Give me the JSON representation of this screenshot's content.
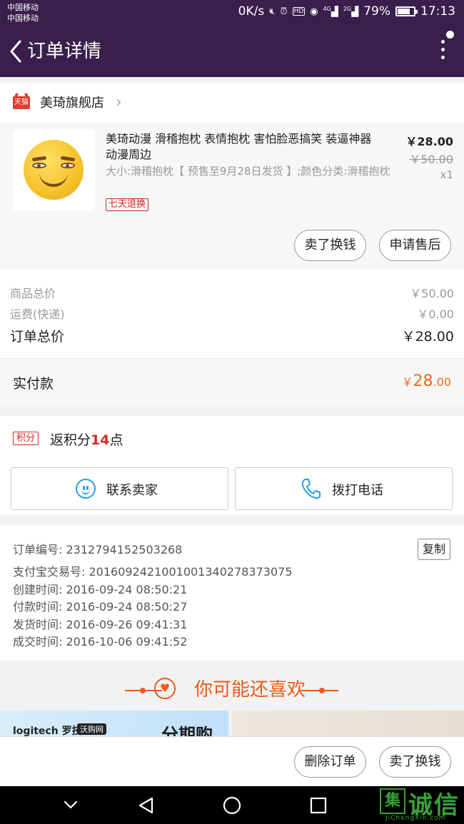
{
  "status_bar": {
    "carrier_1": "中国移动",
    "carrier_2": "中国移动",
    "speed": "0K/s",
    "net_4g": "4G",
    "net_2g": "2G",
    "battery": "79%",
    "battery_level": 0.79,
    "time": "17:13"
  },
  "header": {
    "title": "订单详情"
  },
  "shop": {
    "badge": "天猫",
    "name": "美琦旗舰店"
  },
  "product": {
    "title": "美琦动漫 滑稽抱枕 表情抱枕 害怕脸恶搞笑 装逼神器 动漫周边",
    "spec": "大小:滑稽抱枕【 预售至9月28日发货 】;颜色分类:滑稽抱枕",
    "return_tag": "七天退换",
    "price": "￥28.00",
    "original_price": "￥50.00",
    "quantity": "x1",
    "btn_sell": "卖了换钱",
    "btn_aftersale": "申请售后"
  },
  "totals": {
    "goods_label": "商品总价",
    "goods_value": "￥50.00",
    "shipping_label": "运费(快递)",
    "shipping_value": "￥0.00",
    "order_label": "订单总价",
    "order_value": "￥28.00",
    "paid_label": "实付款",
    "paid_symbol": "￥",
    "paid_int": "28",
    "paid_dec": ".00"
  },
  "points": {
    "tag": "积分",
    "text_prefix": "返积分",
    "amount": "14",
    "text_suffix": "点"
  },
  "contact": {
    "seller_label": "联系卖家",
    "call_label": "拨打电话"
  },
  "order_info": {
    "order_no": "订单编号: 2312794152503268",
    "copy_label": "复制",
    "alipay_no": "支付宝交易号: 2016092421001001340278373075",
    "created": "创建时间: 2016-09-24 08:50:21",
    "paid": "付款时间: 2016-09-24 08:50:27",
    "shipped": "发货时间: 2016-09-26 09:41:31",
    "completed": "成交时间: 2016-10-06 09:41:52"
  },
  "recommend": {
    "title": "你可能还喜欢",
    "ad_logo": "logitech 罗技",
    "ad_tag": "沃购网",
    "ad_big": "分期购"
  },
  "bottom_bar": {
    "delete_label": "删除订单",
    "sell_label": "卖了换钱"
  },
  "watermark": {
    "box": "集",
    "text": "诚信",
    "sub": "JiChengXin.com"
  }
}
